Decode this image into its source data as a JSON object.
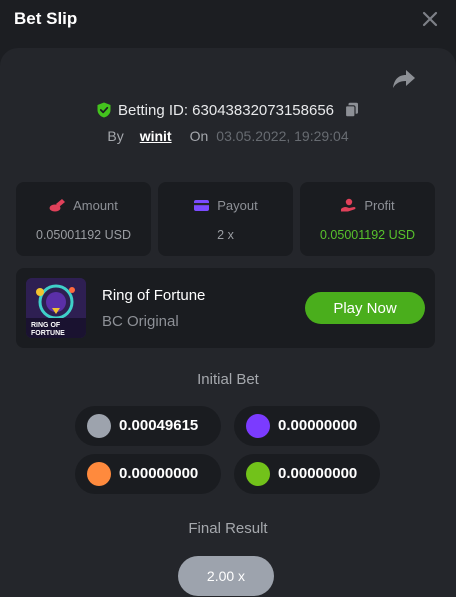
{
  "header": {
    "title": "Bet Slip"
  },
  "bet": {
    "id_label": "Betting ID: 63043832073158656",
    "by_label": "By",
    "username": "winit",
    "on_label": "On",
    "datetime": "03.05.2022, 19:29:04"
  },
  "stats": {
    "amount": {
      "label": "Amount",
      "value": "0.05001192 USD",
      "icon": "coins-icon",
      "color": "#e0415a"
    },
    "payout": {
      "label": "Payout",
      "value": "2 x",
      "icon": "card-icon",
      "color": "#7b4bff"
    },
    "profit": {
      "label": "Profit",
      "value": "0.05001192 USD",
      "icon": "hand-coin-icon",
      "color": "#e0415a",
      "value_color": "#58c22c"
    }
  },
  "game": {
    "name": "Ring of Fortune",
    "provider": "BC Original",
    "play_label": "Play Now",
    "thumb_text": "RING OF FORTUNE"
  },
  "initial_bet": {
    "title": "Initial Bet",
    "chips": [
      {
        "value": "0.00049615",
        "color": "#9da3ad"
      },
      {
        "value": "0.00000000",
        "color": "#7b3bff"
      },
      {
        "value": "0.00000000",
        "color": "#ff8a3d"
      },
      {
        "value": "0.00000000",
        "color": "#72c21a"
      }
    ]
  },
  "final_result": {
    "title": "Final Result",
    "value": "2.00 x"
  }
}
